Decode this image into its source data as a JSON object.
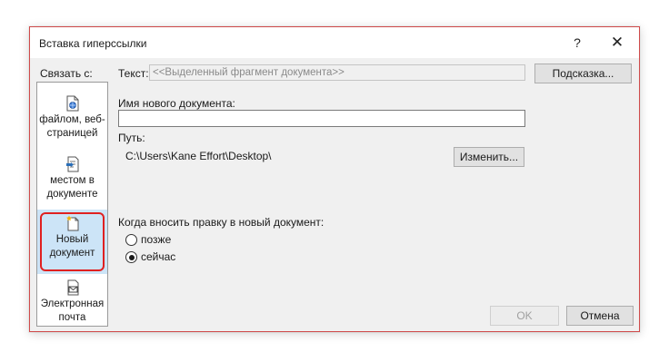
{
  "dialog": {
    "title": "Вставка гиперссылки",
    "help": "?",
    "close": "✕"
  },
  "link_to": {
    "label": "Связать с:",
    "items": [
      {
        "label": "файлом, веб-страницей",
        "icon": "web-page-icon",
        "selected": false
      },
      {
        "label": "местом в документе",
        "icon": "bookmark-page-icon",
        "selected": false
      },
      {
        "label": "Новый документ",
        "icon": "new-document-icon",
        "selected": true
      },
      {
        "label": "Электронная почта",
        "icon": "email-icon",
        "selected": false
      }
    ]
  },
  "text_display": {
    "label": "Текст:",
    "value": "<<Выделенный фрагмент документа>>"
  },
  "tooltip_button": "Подсказка...",
  "new_document": {
    "name_label": "Имя нового документа:",
    "name_value": "",
    "path_label": "Путь:",
    "path_value": "C:\\Users\\Kane Effort\\Desktop\\",
    "change_button": "Изменить..."
  },
  "edit_when": {
    "label": "Когда вносить правку в новый документ:",
    "options": [
      {
        "label": "позже",
        "checked": false
      },
      {
        "label": "сейчас",
        "checked": true
      }
    ]
  },
  "footer": {
    "ok": "OK",
    "cancel": "Отмена"
  },
  "colors": {
    "dialog_border": "#cf4a4a",
    "selected_bg": "#cce4f7",
    "highlight_ring": "#e02020"
  }
}
